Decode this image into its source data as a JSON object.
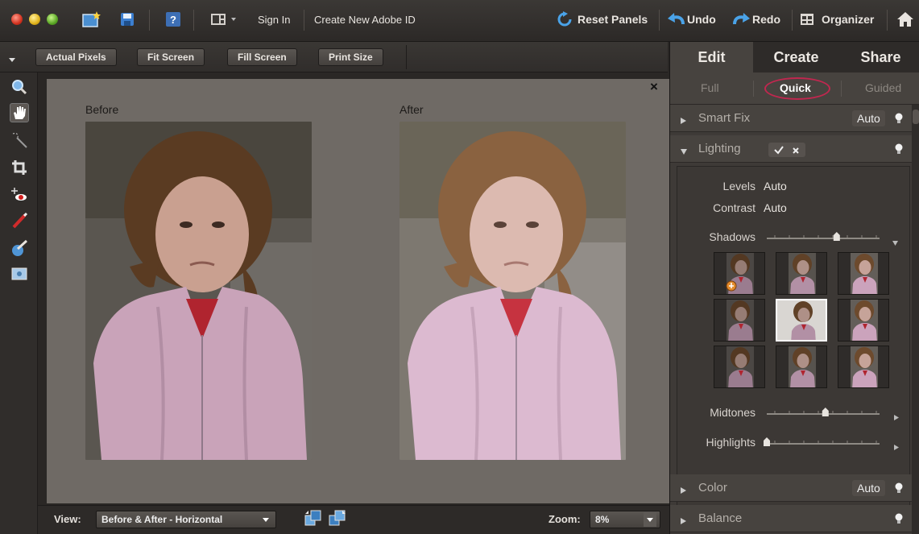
{
  "menubar": {
    "sign_in": "Sign In",
    "create_id": "Create New Adobe ID",
    "reset_panels": "Reset Panels",
    "undo": "Undo",
    "redo": "Redo",
    "organizer": "Organizer"
  },
  "options": {
    "actual_pixels": "Actual Pixels",
    "fit_screen": "Fit Screen",
    "fill_screen": "Fill Screen",
    "print_size": "Print Size"
  },
  "canvas": {
    "before_label": "Before",
    "after_label": "After",
    "close": "×"
  },
  "statusbar": {
    "view_label": "View:",
    "view_value": "Before & After - Horizontal",
    "zoom_label": "Zoom:",
    "zoom_value": "8%"
  },
  "panel": {
    "tabs": [
      "Edit",
      "Create",
      "Share"
    ],
    "subtabs": [
      "Full",
      "Quick",
      "Guided"
    ],
    "smart_fix": {
      "title": "Smart Fix",
      "auto": "Auto"
    },
    "lighting": {
      "title": "Lighting",
      "levels_label": "Levels",
      "levels_value": "Auto",
      "contrast_label": "Contrast",
      "contrast_value": "Auto",
      "shadows_label": "Shadows",
      "shadows_level": 0.62,
      "midtones_label": "Midtones",
      "midtones_level": 0.52,
      "highlights_label": "Highlights",
      "highlights_level": 0.0,
      "selected_thumb": 4
    },
    "color": {
      "title": "Color",
      "auto": "Auto"
    },
    "balance": {
      "title": "Balance"
    }
  },
  "colors": {
    "accent_ring": "#c0274f",
    "undo_redo_blue": "#4aa3e8"
  }
}
